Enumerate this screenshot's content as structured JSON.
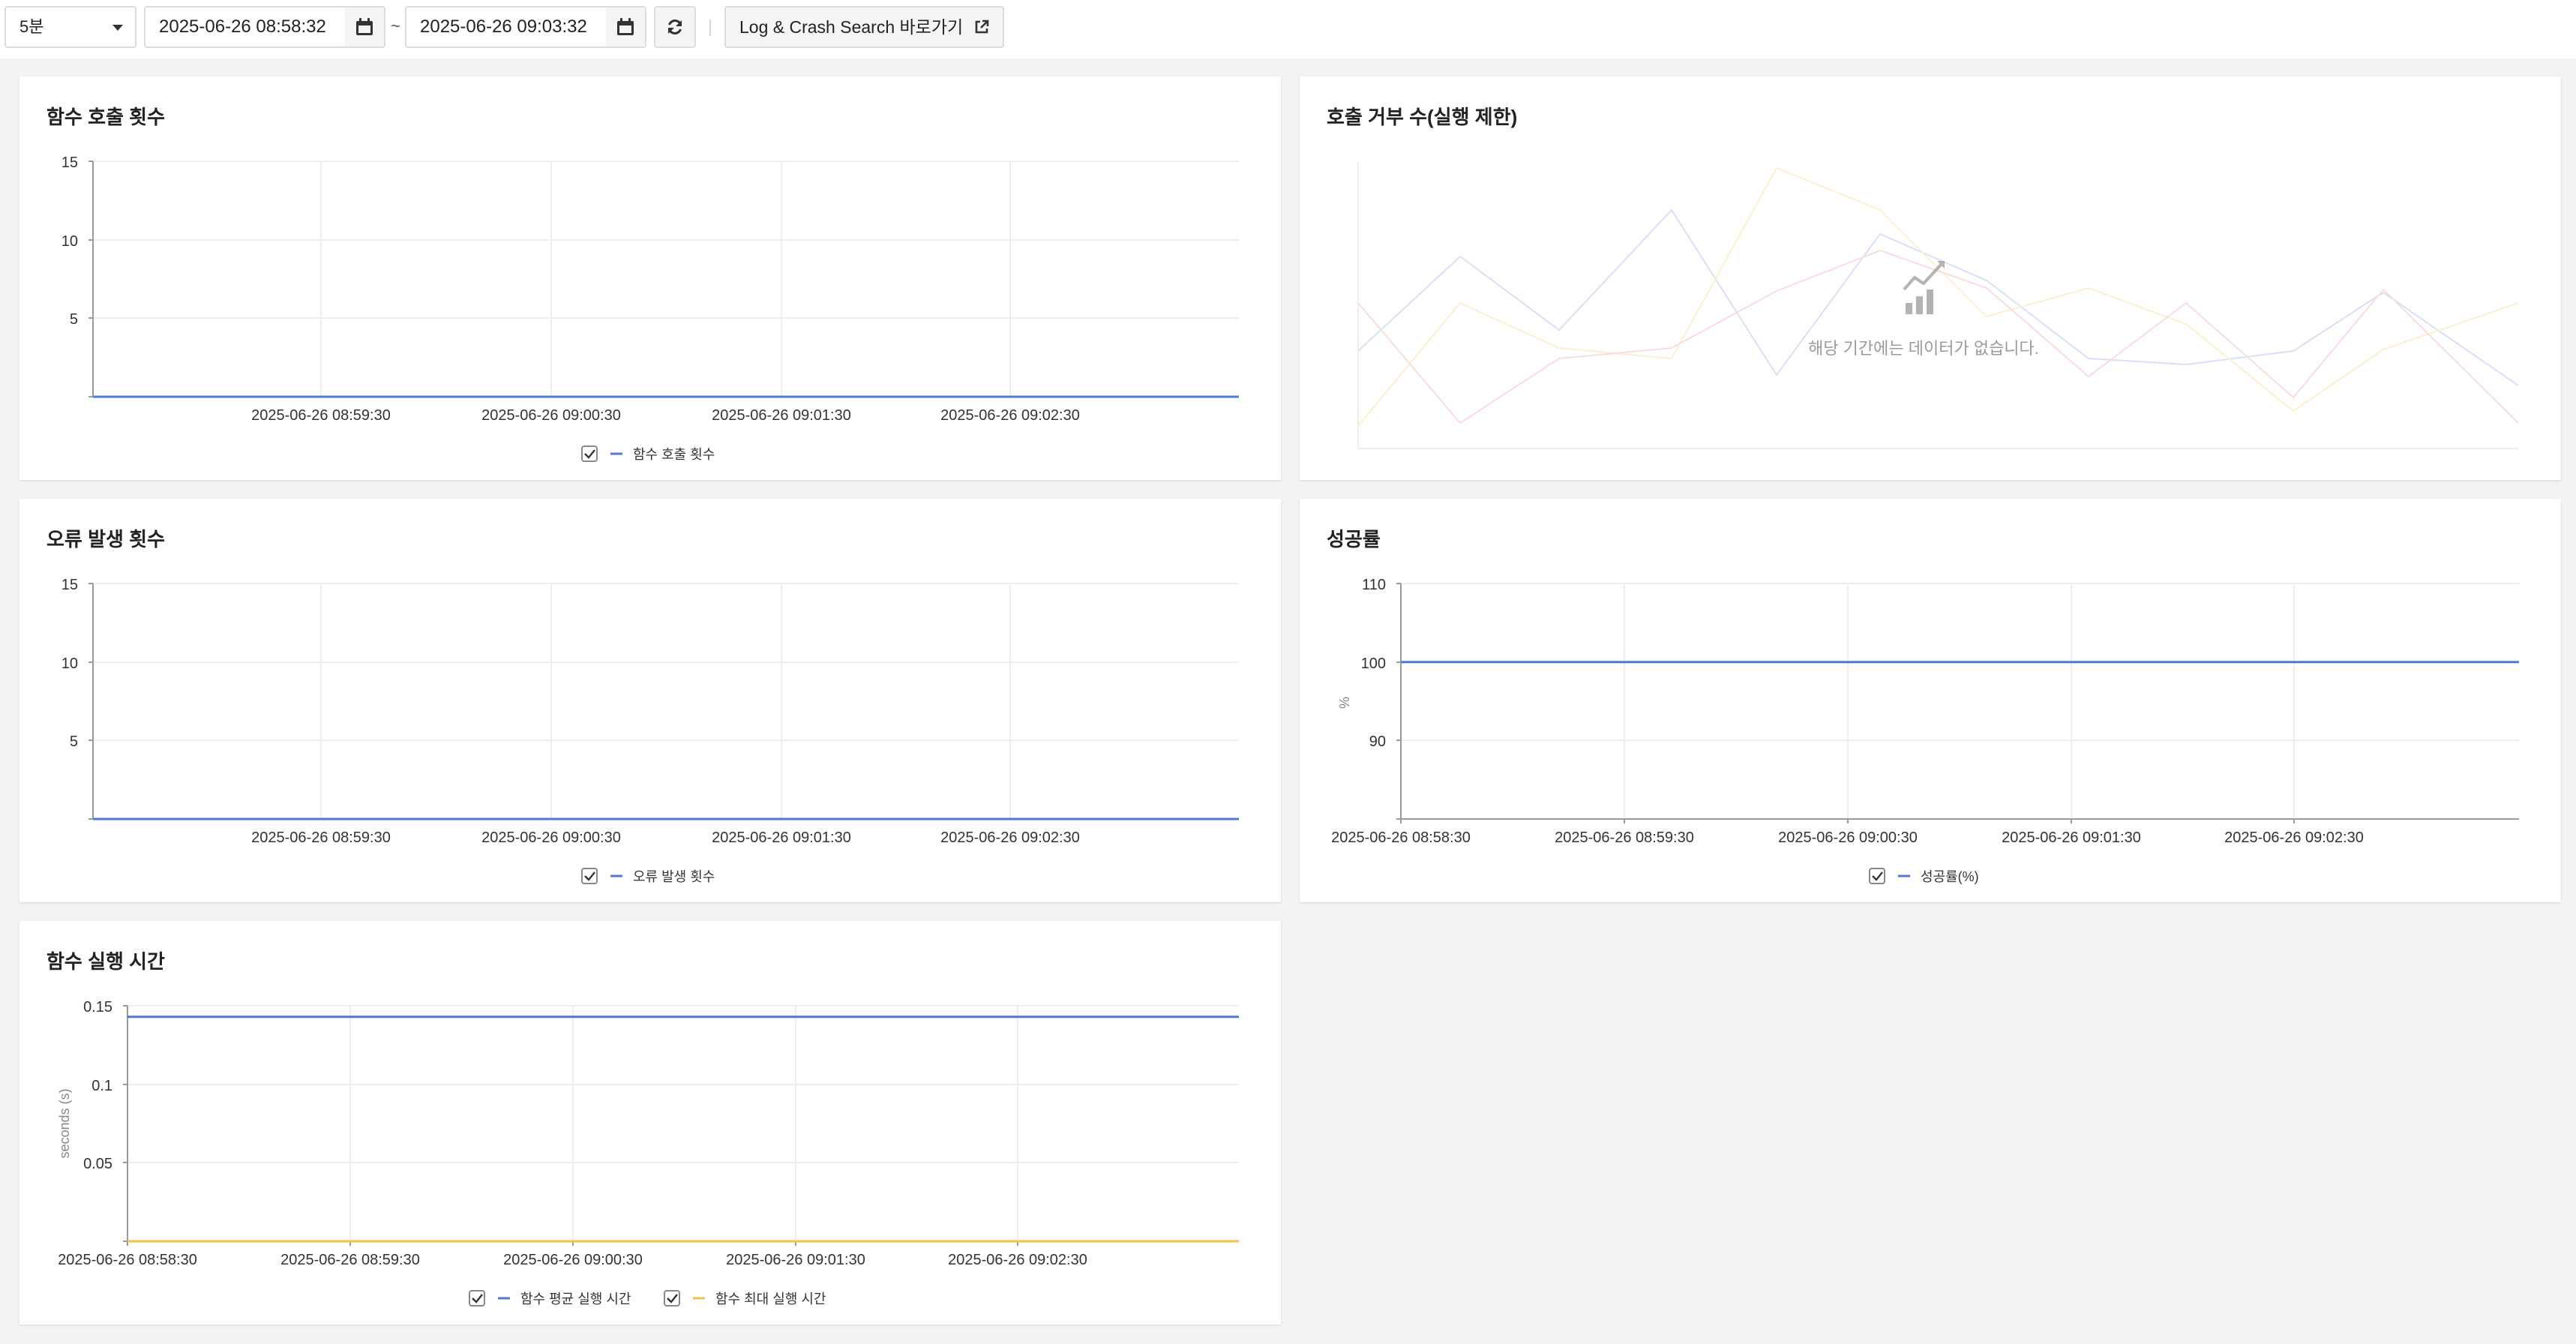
{
  "toolbar": {
    "interval": "5분",
    "start_datetime": "2025-06-26 08:58:32",
    "separator": "~",
    "end_datetime": "2025-06-26 09:03:32",
    "link_label": "Log & Crash Search 바로가기",
    "icons": [
      "calendar-icon",
      "refresh-icon",
      "external-link-icon"
    ]
  },
  "colors": {
    "blue": "#4e79d8",
    "yellow": "#f2c14e",
    "pink": "#f29ca3",
    "grid": "#eeeeee",
    "axis": "#9a9a9a"
  },
  "panels": {
    "invocations": {
      "title": "함수 호출 횟수",
      "legend": [
        "함수 호출 횟수"
      ],
      "x_ticks": [
        "2025-06-26 08:59:30",
        "2025-06-26 09:00:30",
        "2025-06-26 09:01:30",
        "2025-06-26 09:02:30"
      ],
      "y_ticks": [
        "15",
        "10",
        "5"
      ]
    },
    "throttles": {
      "title": "호출 거부 수(실행 제한)",
      "no_data_message": "해당 기간에는 데이터가 없습니다."
    },
    "errors": {
      "title": "오류 발생 횟수",
      "legend": [
        "오류 발생 횟수"
      ],
      "x_ticks": [
        "2025-06-26 08:59:30",
        "2025-06-26 09:00:30",
        "2025-06-26 09:01:30",
        "2025-06-26 09:02:30"
      ],
      "y_ticks": [
        "15",
        "10",
        "5"
      ]
    },
    "success_rate": {
      "title": "성공률",
      "ylabel": "%",
      "legend": [
        "성공률(%)"
      ],
      "x_ticks": [
        "2025-06-26 08:58:30",
        "2025-06-26 08:59:30",
        "2025-06-26 09:00:30",
        "2025-06-26 09:01:30",
        "2025-06-26 09:02:30"
      ],
      "y_ticks": [
        "110",
        "100",
        "90"
      ]
    },
    "duration": {
      "title": "함수 실행 시간",
      "ylabel": "seconds (s)",
      "legend": [
        "함수 평균 실행 시간",
        "함수 최대 실행 시간"
      ],
      "x_ticks": [
        "2025-06-26 08:58:30",
        "2025-06-26 08:59:30",
        "2025-06-26 09:00:30",
        "2025-06-26 09:01:30",
        "2025-06-26 09:02:30"
      ],
      "y_ticks": [
        "0.15",
        "0.1",
        "0.05"
      ]
    }
  },
  "chart_data": [
    {
      "type": "line",
      "title": "함수 호출 횟수",
      "x": [
        "2025-06-26 08:58:32",
        "2025-06-26 09:03:32"
      ],
      "series": [
        {
          "name": "함수 호출 횟수",
          "values": [
            0,
            0
          ]
        }
      ],
      "ylim": [
        0,
        15
      ],
      "grid": true,
      "legend": "bottom"
    },
    {
      "type": "line",
      "title": "호출 거부 수(실행 제한)",
      "series": [],
      "grid": true
    },
    {
      "type": "line",
      "title": "오류 발생 횟수",
      "x": [
        "2025-06-26 08:58:32",
        "2025-06-26 09:03:32"
      ],
      "series": [
        {
          "name": "오류 발생 횟수",
          "values": [
            0,
            0
          ]
        }
      ],
      "ylim": [
        0,
        15
      ],
      "grid": true,
      "legend": "bottom"
    },
    {
      "type": "line",
      "title": "성공률",
      "ylabel": "%",
      "x": [
        "2025-06-26 08:58:30",
        "2025-06-26 09:03:32"
      ],
      "series": [
        {
          "name": "성공률(%)",
          "values": [
            100,
            100
          ]
        }
      ],
      "ylim": [
        80,
        110
      ],
      "grid": true,
      "legend": "bottom"
    },
    {
      "type": "line",
      "title": "함수 실행 시간",
      "ylabel": "seconds (s)",
      "x": [
        "2025-06-26 08:58:30",
        "2025-06-26 09:03:32"
      ],
      "series": [
        {
          "name": "함수 평균 실행 시간",
          "values": [
            0.143,
            0.143
          ]
        },
        {
          "name": "함수 최대 실행 시간",
          "values": [
            0,
            0
          ]
        }
      ],
      "ylim": [
        0,
        0.15
      ],
      "grid": true,
      "legend": "bottom"
    }
  ]
}
